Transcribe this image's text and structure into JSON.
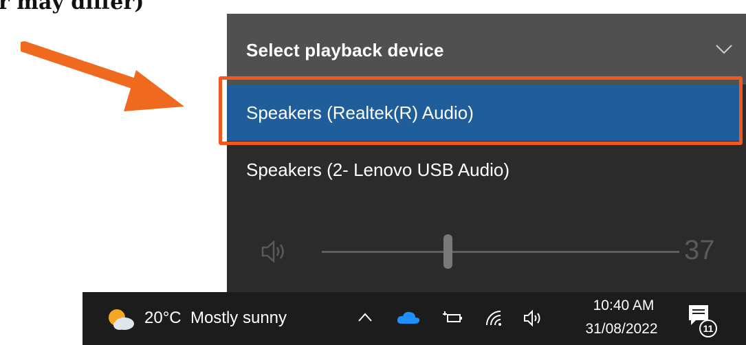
{
  "caption": "r may differ)",
  "flyout": {
    "title": "Select playback device",
    "devices": [
      {
        "label": "Speakers (Realtek(R) Audio)",
        "selected": true
      },
      {
        "label": "Speakers (2- Lenovo USB Audio)",
        "selected": false
      }
    ],
    "volume": "37",
    "volume_level_percent": 37
  },
  "taskbar": {
    "temperature": "20°C",
    "weather": "Mostly sunny",
    "time": "10:40 AM",
    "date": "31/08/2022",
    "notification_count": "11"
  },
  "colors": {
    "highlight": "#f0581e",
    "selected_bg": "#1f5d9b",
    "header_bg": "#505050",
    "panel_bg": "#2b2b2b",
    "taskbar_bg": "#1c1c1c"
  }
}
